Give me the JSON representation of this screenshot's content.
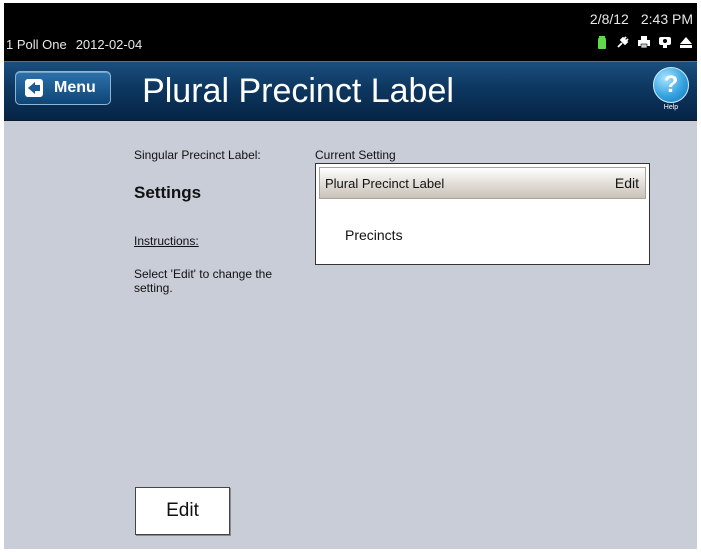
{
  "status": {
    "poll": "1 Poll One",
    "date_code": "2012-02-04",
    "date": "2/8/12",
    "time": "2:43 PM",
    "icons": [
      "battery-icon",
      "power-plug-icon",
      "printer-icon",
      "network-icon",
      "eject-icon"
    ]
  },
  "header": {
    "menu_label": "Menu",
    "title": "Plural Precinct Label",
    "help_label": "Help",
    "help_glyph": "?"
  },
  "left": {
    "singular_label": "Singular Precinct Label:",
    "section_name": "Settings",
    "instructions_title": "Instructions:",
    "instructions_text": "Select 'Edit' to change the setting."
  },
  "current_setting": {
    "label": "Current Setting",
    "row_title": "Plural Precinct Label",
    "edit_label": "Edit",
    "value": "Precincts"
  },
  "edit_button_label": "Edit",
  "colors": {
    "background": "#c8cdd8",
    "header_blue": "#0d3760",
    "battery": "#5fd84a"
  }
}
